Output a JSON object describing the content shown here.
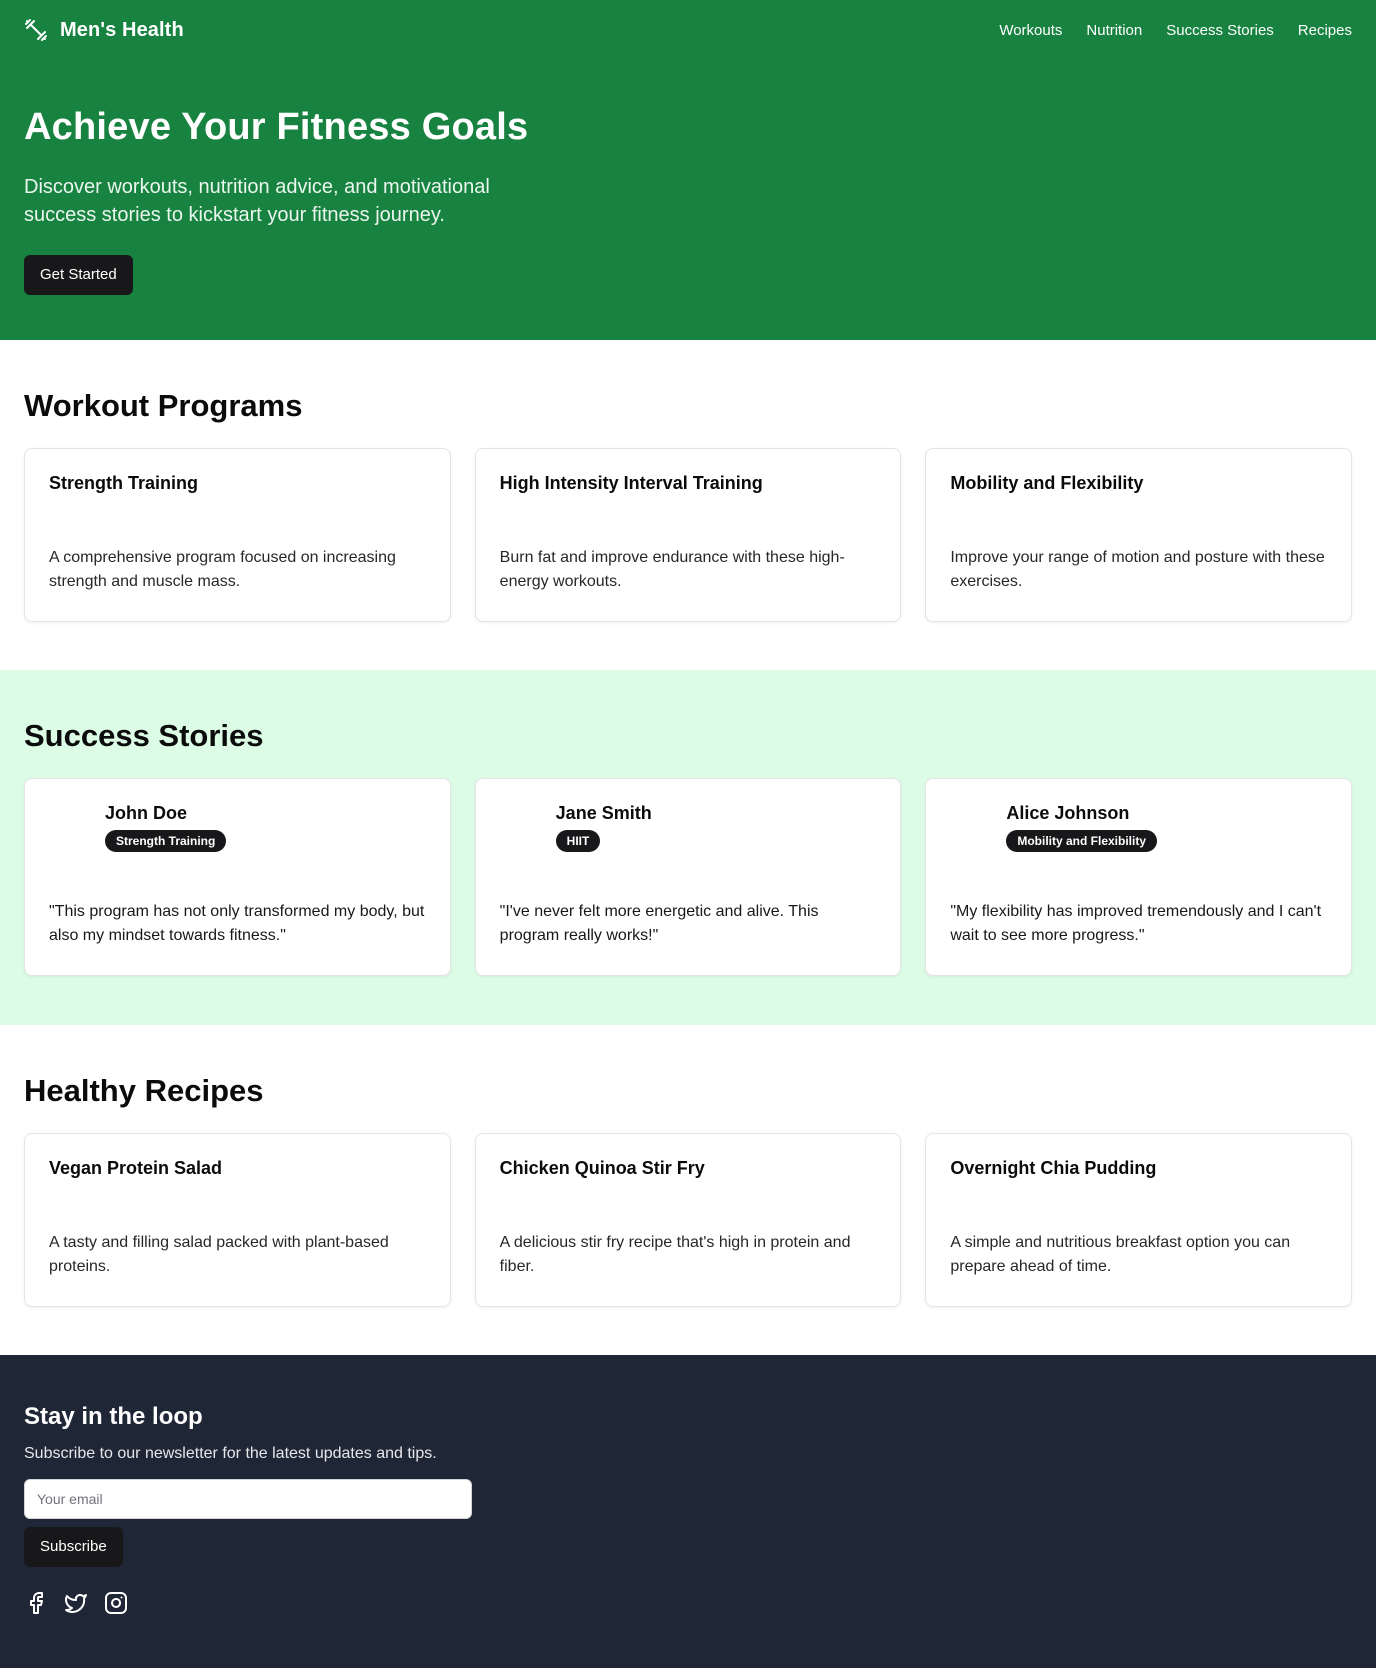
{
  "header": {
    "brand": "Men's Health",
    "nav": [
      "Workouts",
      "Nutrition",
      "Success Stories",
      "Recipes"
    ]
  },
  "hero": {
    "title": "Achieve Your Fitness Goals",
    "subtitle": "Discover workouts, nutrition advice, and motivational success stories to kickstart your fitness journey.",
    "cta": "Get Started"
  },
  "workouts": {
    "title": "Workout Programs",
    "items": [
      {
        "title": "Strength Training",
        "desc": "A comprehensive program focused on increasing strength and muscle mass."
      },
      {
        "title": "High Intensity Interval Training",
        "desc": "Burn fat and improve endurance with these high-energy workouts."
      },
      {
        "title": "Mobility and Flexibility",
        "desc": "Improve your range of motion and posture with these exercises."
      }
    ]
  },
  "stories": {
    "title": "Success Stories",
    "items": [
      {
        "name": "John Doe",
        "badge": "Strength Training",
        "quote": "\"This program has not only transformed my body, but also my mindset towards fitness.\""
      },
      {
        "name": "Jane Smith",
        "badge": "HIIT",
        "quote": "\"I've never felt more energetic and alive. This program really works!\""
      },
      {
        "name": "Alice Johnson",
        "badge": "Mobility and Flexibility",
        "quote": "\"My flexibility has improved tremendously and I can't wait to see more progress.\""
      }
    ]
  },
  "recipes": {
    "title": "Healthy Recipes",
    "items": [
      {
        "title": "Vegan Protein Salad",
        "desc": "A tasty and filling salad packed with plant-based proteins."
      },
      {
        "title": "Chicken Quinoa Stir Fry",
        "desc": "A delicious stir fry recipe that's high in protein and fiber."
      },
      {
        "title": "Overnight Chia Pudding",
        "desc": "A simple and nutritious breakfast option you can prepare ahead of time."
      }
    ]
  },
  "footer": {
    "title": "Stay in the loop",
    "subtitle": "Subscribe to our newsletter for the latest updates and tips.",
    "email_placeholder": "Your email",
    "subscribe": "Subscribe",
    "socials": [
      "facebook-icon",
      "twitter-icon",
      "instagram-icon"
    ]
  },
  "colors": {
    "hero_bg": "#188341",
    "stories_bg": "#dcfce6",
    "footer_bg": "#1f2636",
    "button_dark": "#18181b"
  }
}
